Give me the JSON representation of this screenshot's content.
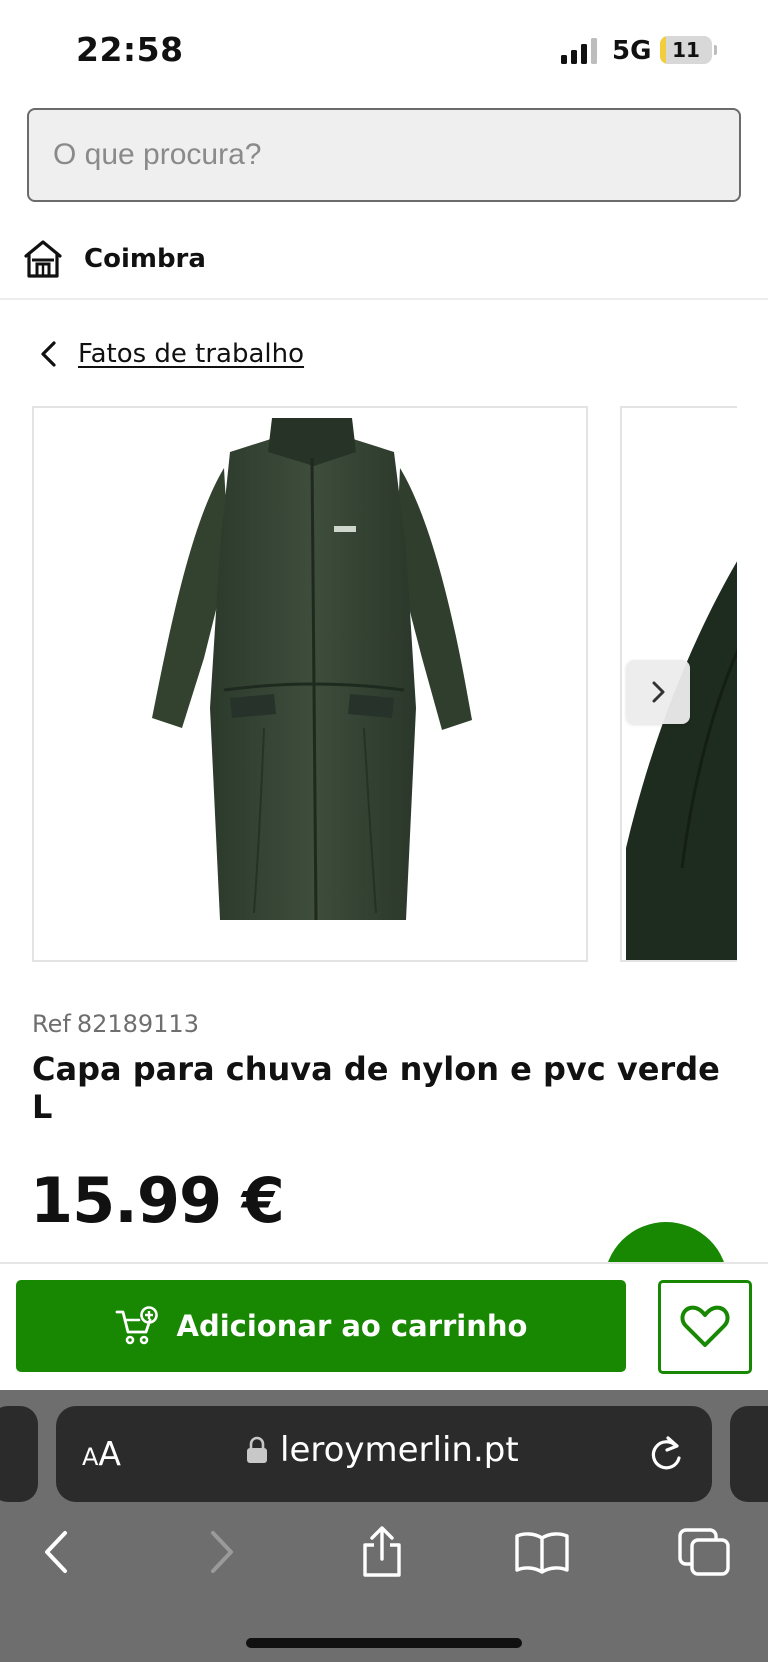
{
  "status_bar": {
    "time": "22:58",
    "network": "5G",
    "battery_level": "11",
    "battery_fraction": 0.11
  },
  "search": {
    "placeholder": "O que procura?"
  },
  "store": {
    "name": "Coimbra",
    "icon": "store-house-icon"
  },
  "breadcrumb": {
    "label": "Fatos de trabalho",
    "icon": "chevron-left-icon"
  },
  "gallery": {
    "next_icon": "chevron-right-icon"
  },
  "product": {
    "ref_label": "Ref",
    "ref_number": "82189113",
    "title": "Capa para chuva de nylon e pvc verde L",
    "price": "15.99 €"
  },
  "actions": {
    "add_to_cart": "Adicionar ao carrinho",
    "cart_icon": "cart-add-icon",
    "favorite_icon": "heart-icon"
  },
  "browser": {
    "aa_small": "A",
    "aa_big": "A",
    "url": "leroymerlin.pt"
  },
  "colors": {
    "brand_green": "#188803",
    "text": "#111111",
    "muted": "#6e6e6e",
    "browser_bg": "#6e6e6e",
    "url_bar_bg": "#2b2b2b"
  }
}
